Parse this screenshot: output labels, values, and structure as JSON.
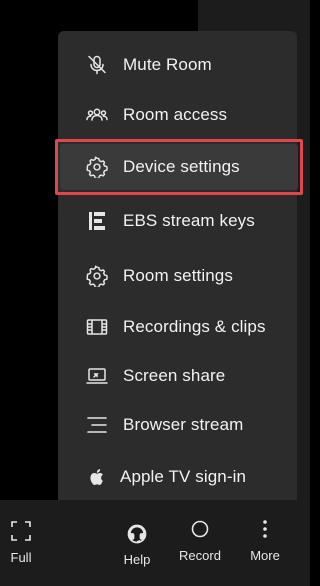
{
  "menu": {
    "items": [
      {
        "label": "Mute Room",
        "icon": "mic-off-icon"
      },
      {
        "label": "Room access",
        "icon": "people-icon"
      },
      {
        "label": "Device settings",
        "icon": "gear-icon",
        "highlighted": true
      },
      {
        "label": "EBS stream keys",
        "icon": "ebs-logo-icon"
      },
      {
        "label": "Room settings",
        "icon": "gear-icon"
      },
      {
        "label": "Recordings & clips",
        "icon": "film-icon"
      },
      {
        "label": "Screen share",
        "icon": "laptop-icon"
      },
      {
        "label": "Browser stream",
        "icon": "lines-icon"
      },
      {
        "label": "Apple TV sign-in",
        "icon": "apple-icon"
      }
    ]
  },
  "bottom_bar": {
    "full_label": "Full",
    "help_label": "Help",
    "record_label": "Record",
    "more_label": "More"
  },
  "colors": {
    "highlight_border": "#e0474c",
    "menu_bg": "#2c2c2c"
  }
}
